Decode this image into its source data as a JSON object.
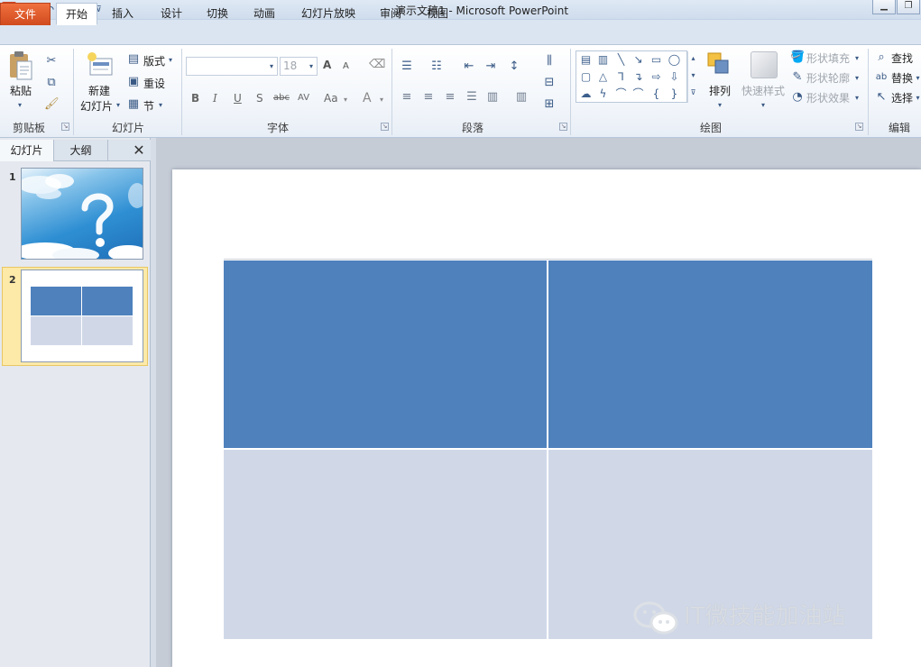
{
  "app": {
    "icon_text": "P",
    "title": "演示文稿1 - Microsoft PowerPoint"
  },
  "tabs": [
    "文件",
    "开始",
    "插入",
    "设计",
    "切换",
    "动画",
    "幻灯片放映",
    "审阅",
    "视图"
  ],
  "ribbon": {
    "clipboard": {
      "label": "剪贴板",
      "paste": "粘贴"
    },
    "slides": {
      "label": "幻灯片",
      "new_slide_line1": "新建",
      "new_slide_line2": "幻灯片",
      "layout": "版式",
      "reset": "重设",
      "section": "节"
    },
    "font": {
      "label": "字体",
      "font_size": "18",
      "bold": "B",
      "italic": "I",
      "underline": "U",
      "shadow": "S",
      "strike": "abc",
      "spacing": "AV",
      "case": "Aa",
      "grow": "A",
      "shrink": "A"
    },
    "paragraph": {
      "label": "段落"
    },
    "drawing": {
      "label": "绘图",
      "arrange": "排列",
      "quick_styles": "快速样式",
      "shape_fill": "形状填充",
      "shape_outline": "形状轮廓",
      "shape_effects": "形状效果"
    },
    "editing": {
      "label": "编辑",
      "find": "查找",
      "replace": "替换",
      "select": "选择"
    }
  },
  "left_pane": {
    "tab_slides": "幻灯片",
    "tab_outline": "大纲",
    "close": "✕",
    "slides": [
      {
        "number": "1"
      },
      {
        "number": "2"
      }
    ]
  },
  "slide_table": {
    "header_color": "#4f81bd",
    "body_color": "#d0d8e8",
    "rows": 2,
    "cols": 2
  },
  "watermark": "IT微技能加油站"
}
